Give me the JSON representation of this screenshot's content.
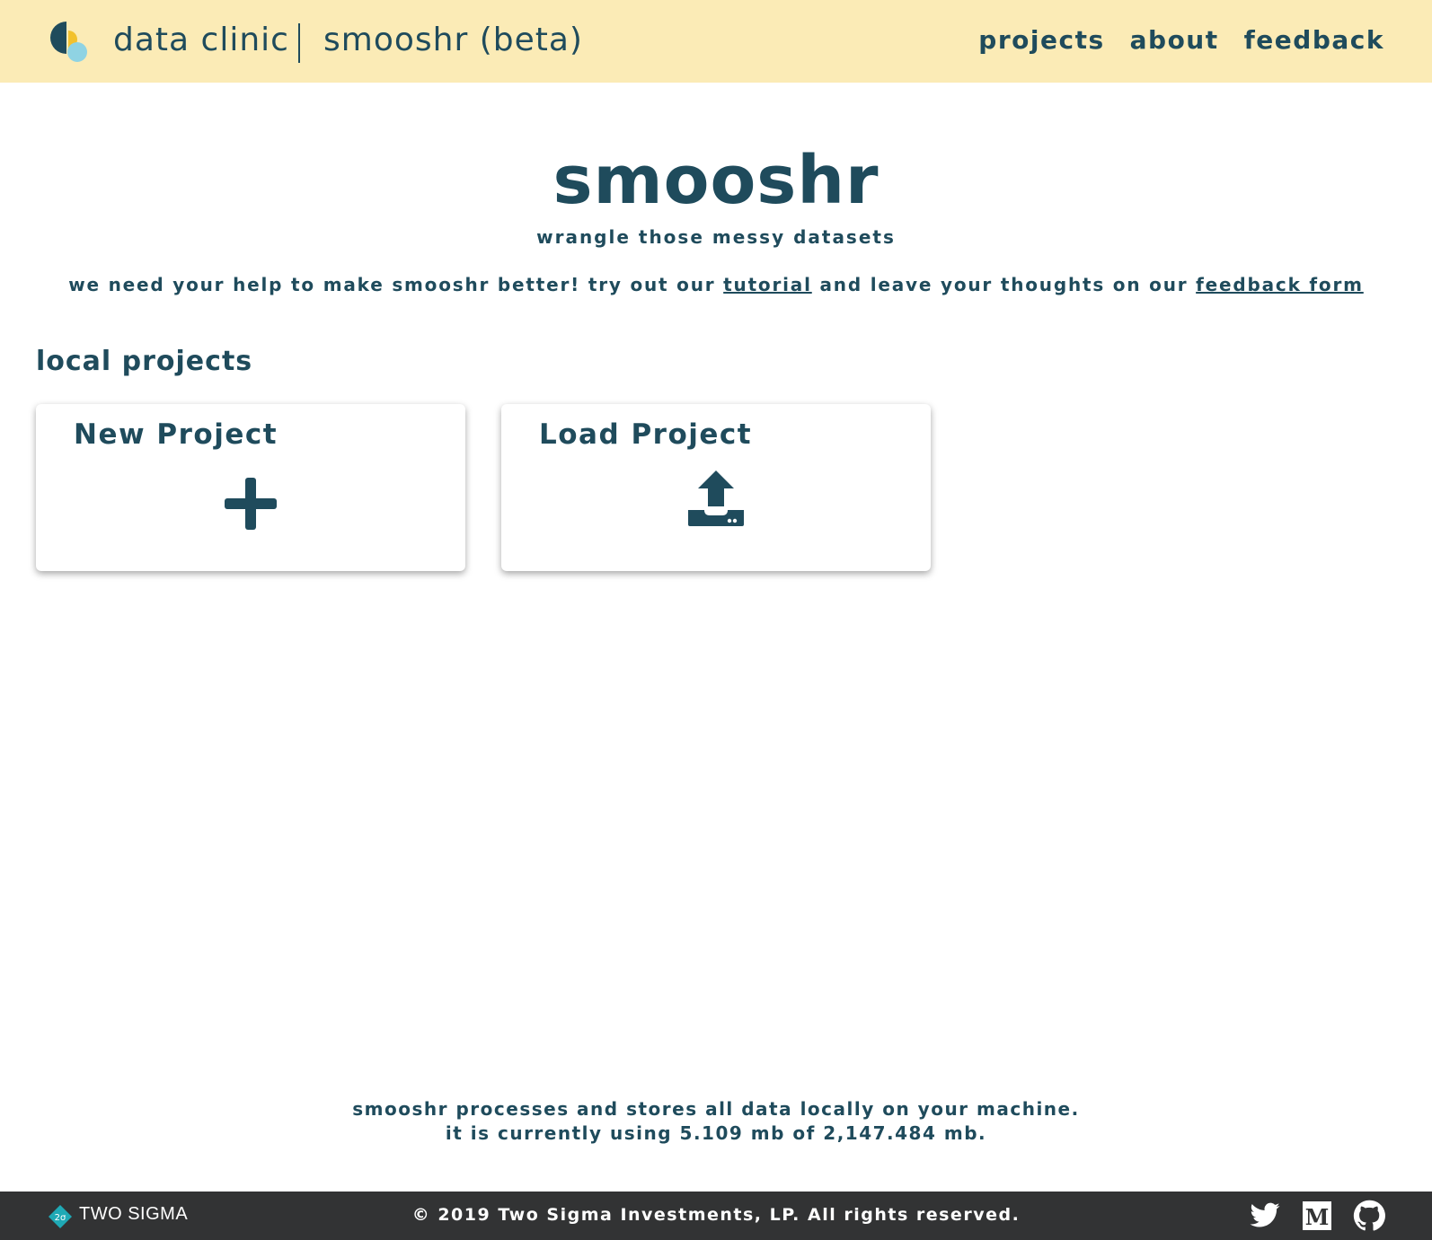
{
  "header": {
    "brand": "data clinic",
    "app_name": "smooshr (beta)",
    "nav": [
      {
        "label": "projects"
      },
      {
        "label": "about"
      },
      {
        "label": "feedback"
      }
    ]
  },
  "hero": {
    "title": "smooshr",
    "subtitle": "wrangle those messy datasets"
  },
  "notice": {
    "text_before": "we need your help to make smooshr better! try out our ",
    "tutorial_link": "tutorial",
    "text_middle": " and leave your thoughts on our ",
    "feedback_link": "feedback form"
  },
  "local_projects": {
    "title": "local projects",
    "cards": [
      {
        "label": "New Project",
        "icon": "plus-icon"
      },
      {
        "label": "Load Project",
        "icon": "upload-icon"
      }
    ]
  },
  "storage": {
    "line1": "smooshr processes and stores all data locally on your machine.",
    "line2": "it is currently using 5.109 mb of 2,147.484 mb."
  },
  "footer": {
    "company": "TWO SIGMA",
    "copyright": "© 2019 Two Sigma Investments, LP. All rights reserved.",
    "social": [
      "twitter-icon",
      "medium-icon",
      "github-icon"
    ]
  },
  "colors": {
    "header_bg": "#fbebb6",
    "text": "#1f4b5c",
    "footer_bg": "#323334"
  }
}
